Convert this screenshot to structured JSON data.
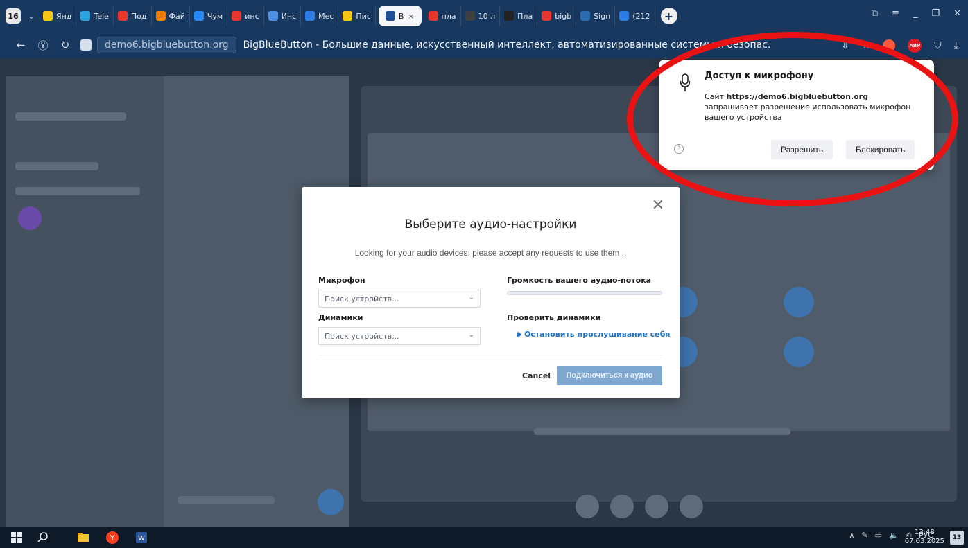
{
  "browser": {
    "tab_count": "16",
    "tabs": [
      {
        "label": "Янд",
        "color": "#f5c518"
      },
      {
        "label": "Tele",
        "color": "#2aa3df"
      },
      {
        "label": "Под",
        "color": "#e5352d"
      },
      {
        "label": "Фай",
        "color": "#f07d00"
      },
      {
        "label": "Чум",
        "color": "#2787f5"
      },
      {
        "label": "инс",
        "color": "#e5352d"
      },
      {
        "label": "Инс",
        "color": "#4d8fe0"
      },
      {
        "label": "Мес",
        "color": "#2d7be5"
      },
      {
        "label": "Пис",
        "color": "#f5c518"
      },
      {
        "label": "В",
        "color": "#1f4f96",
        "active": true
      },
      {
        "label": "пла",
        "color": "#e5352d"
      },
      {
        "label": "10 л",
        "color": "#3f3f3f"
      },
      {
        "label": "Пла",
        "color": "#222222"
      },
      {
        "label": "bigb",
        "color": "#e5352d"
      },
      {
        "label": "Sign",
        "color": "#2b6cb0"
      },
      {
        "label": "(212",
        "color": "#2d7be5"
      }
    ],
    "active_tab_close": "×",
    "new_tab": "+",
    "address": {
      "domain": "demo6.bigbluebutton.org",
      "title": "BigBlueButton - Большие данные, искусственный интеллект, автоматизированные системы и безопас…"
    }
  },
  "audio_modal": {
    "title": "Выберите аудио-настройки",
    "subtitle": "Looking for your audio devices, please accept any requests to use them  ..",
    "microphone_label": "Микрофон",
    "microphone_value": "Поиск устройств...",
    "speakers_label": "Динамики",
    "speakers_value": "Поиск устройств...",
    "volume_label": "Громкость вашего аудио-потока",
    "test_speakers_label": "Проверить динамики",
    "stop_listen": "Остановить прослушивание себя",
    "cancel": "Cancel",
    "connect": "Подключиться к аудио"
  },
  "mic_permission": {
    "title": "Доступ к микрофону",
    "text_prefix": "Сайт ",
    "site": "https://demo6.bigbluebutton.org",
    "text_suffix": " запрашивает разрешение использовать микрофон вашего устройства",
    "allow": "Разрешить",
    "block": "Блокировать",
    "help": "?"
  },
  "taskbar": {
    "lang": "РУС",
    "time": "13:48",
    "date": "07.03.2025",
    "notifications": "13"
  },
  "colors": {
    "annotation": "#ea1212",
    "link": "#1d72c8",
    "connect_button": "#7fa7cf"
  }
}
